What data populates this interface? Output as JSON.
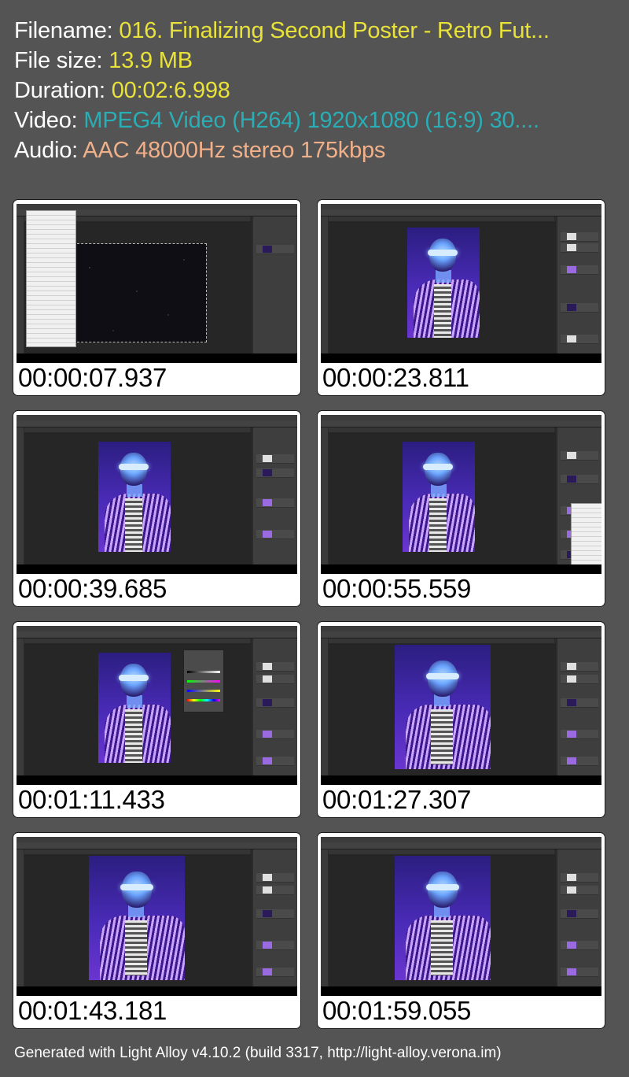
{
  "info": {
    "filename_label": "Filename:",
    "filename_value": "016. Finalizing Second Poster - Retro Fut...",
    "filesize_label": "File size:",
    "filesize_value": "13.9 MB",
    "duration_label": "Duration:",
    "duration_value": "00:02:6.998",
    "video_label": "Video:",
    "video_value": "MPEG4 Video (H264) 1920x1080 (16:9) 30....",
    "audio_label": "Audio:",
    "audio_value": "AAC 48000Hz stereo 175kbps"
  },
  "thumbnails": [
    {
      "timestamp": "00:00:07.937",
      "content": "starfield-canvas-with-edit-menu"
    },
    {
      "timestamp": "00:00:23.811",
      "content": "retro-poster"
    },
    {
      "timestamp": "00:00:39.685",
      "content": "retro-poster"
    },
    {
      "timestamp": "00:00:55.559",
      "content": "retro-poster-with-context-menu"
    },
    {
      "timestamp": "00:01:11.433",
      "content": "retro-poster-with-properties-panel"
    },
    {
      "timestamp": "00:01:27.307",
      "content": "retro-poster-larger"
    },
    {
      "timestamp": "00:01:43.181",
      "content": "retro-poster-larger"
    },
    {
      "timestamp": "00:01:59.055",
      "content": "retro-poster-larger"
    }
  ],
  "footer": "Generated with Light Alloy v4.10.2 (build 3317, http://light-alloy.verona.im)",
  "colors": {
    "background": "#545454",
    "label": "#ffffff",
    "value_yellow": "#e8e23a",
    "value_teal": "#2aaeb6",
    "value_peach": "#f0b08a"
  }
}
